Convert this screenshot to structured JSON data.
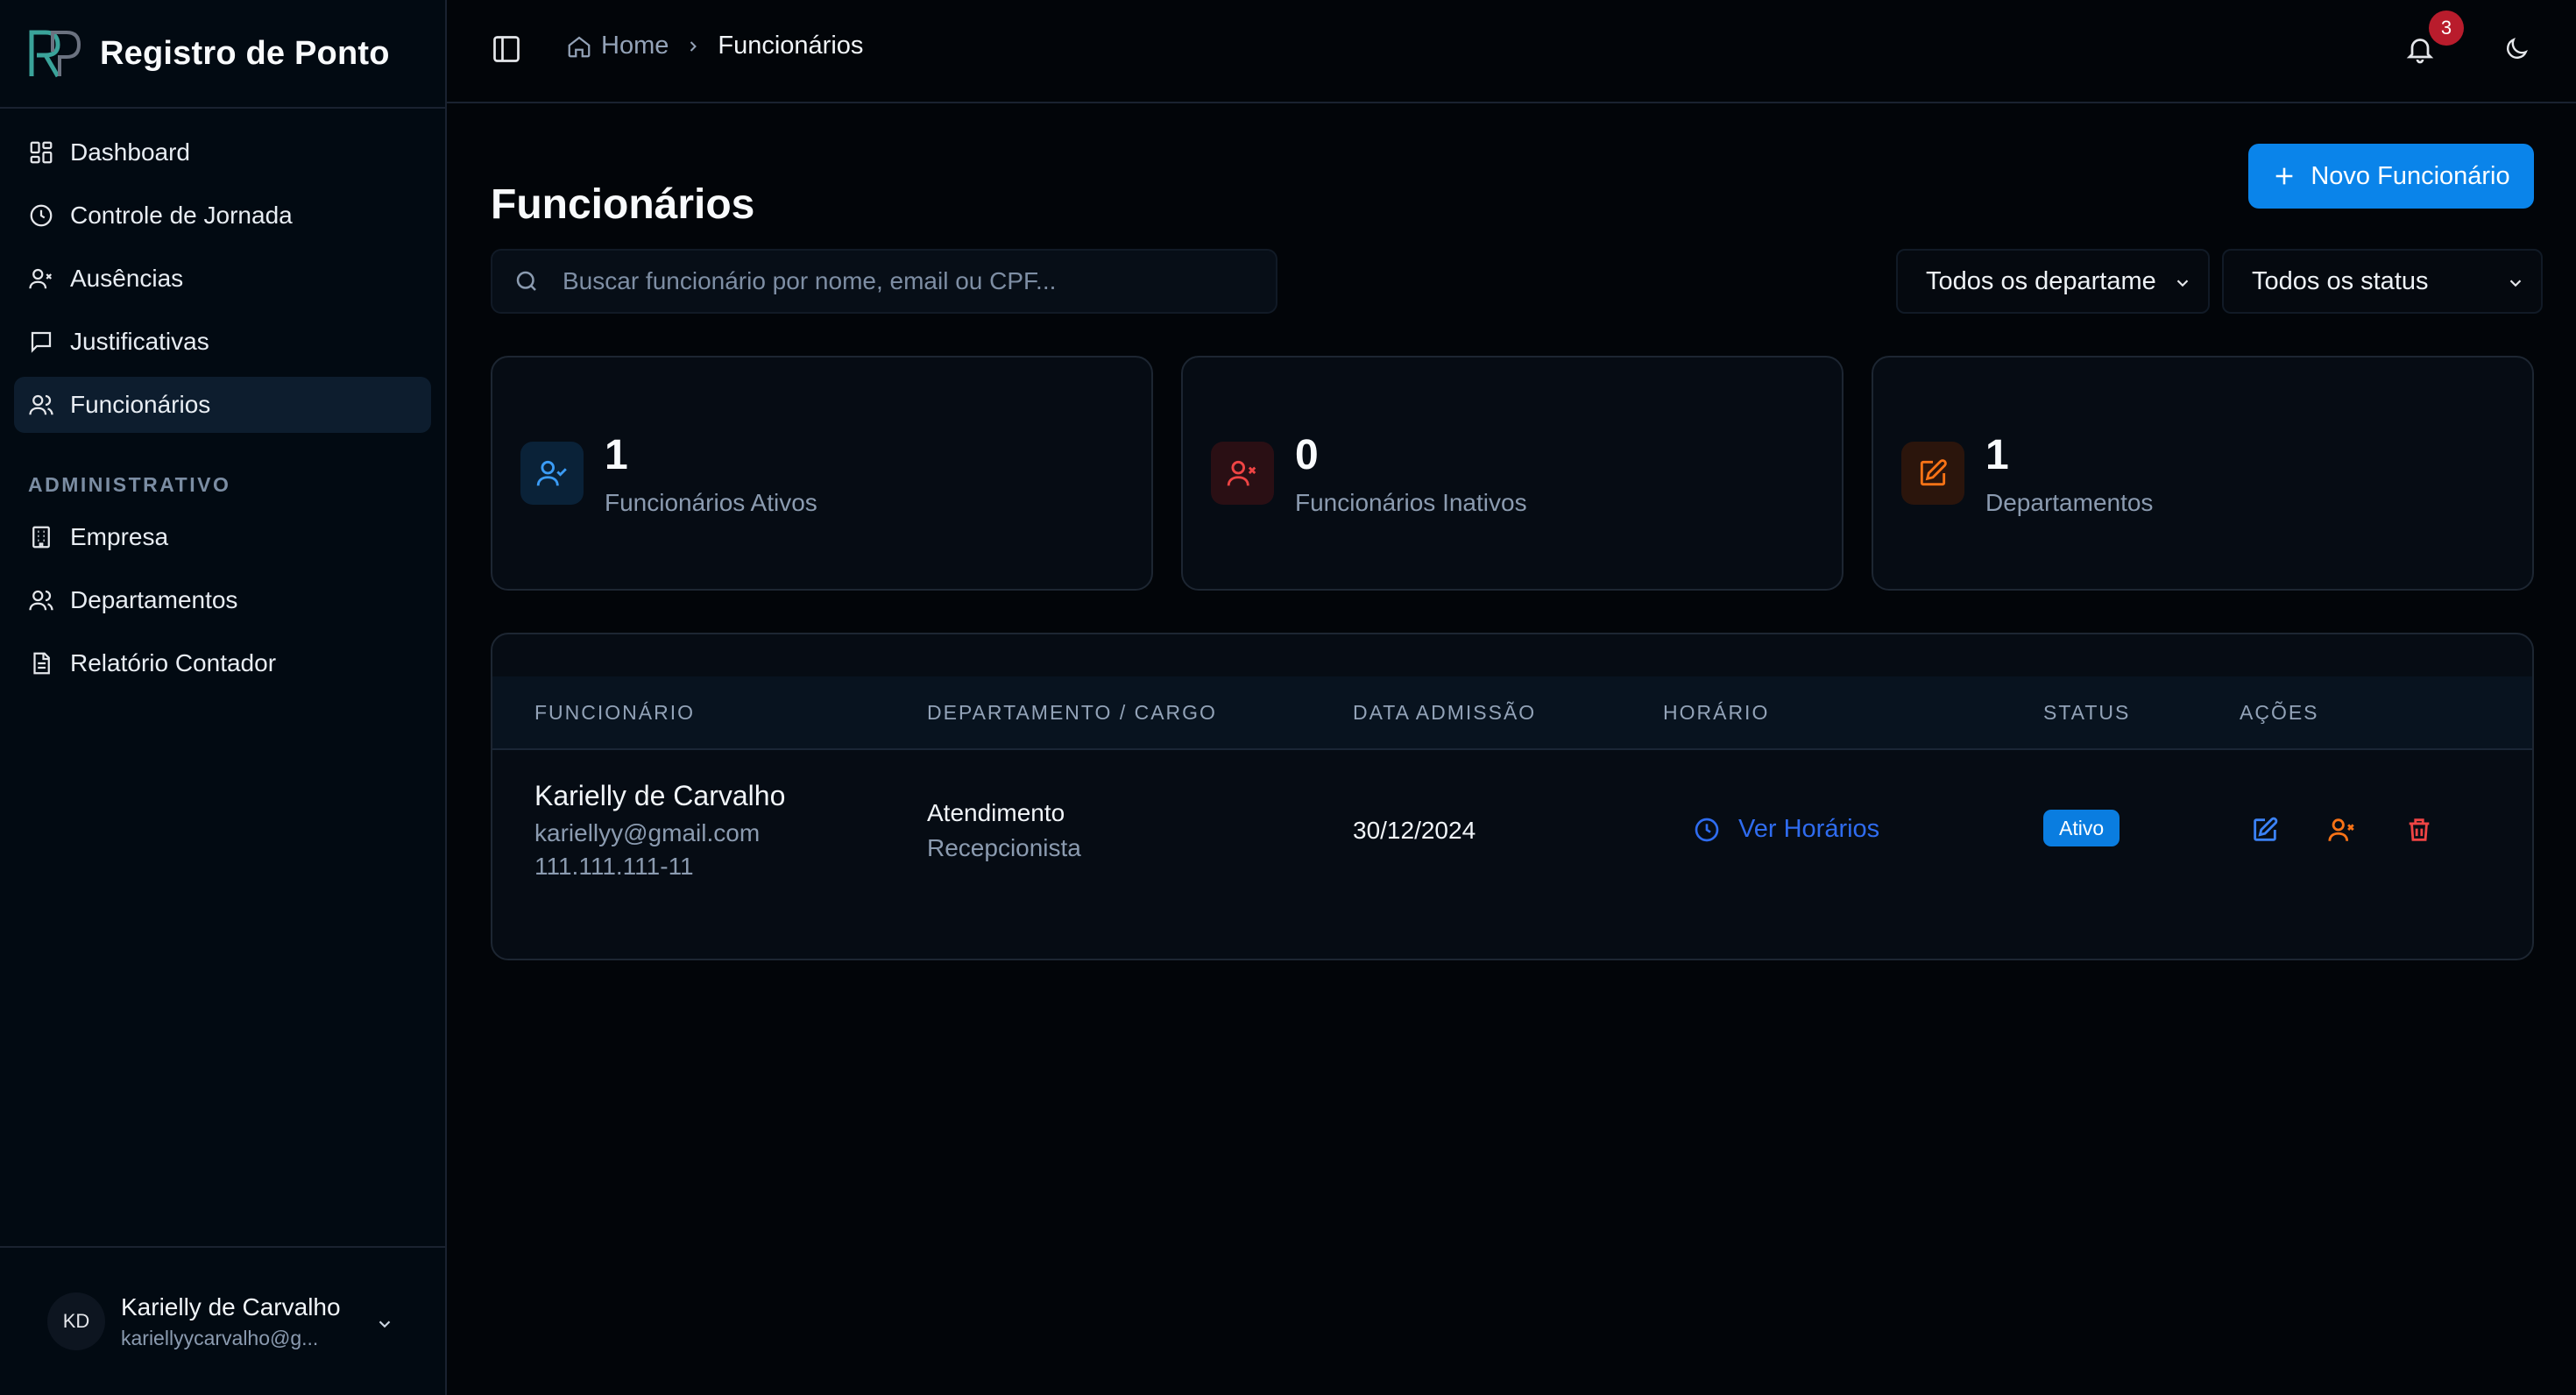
{
  "app": {
    "title": "Registro de Ponto"
  },
  "sidebar": {
    "items": [
      {
        "label": "Dashboard",
        "icon": "dashboard-icon"
      },
      {
        "label": "Controle de Jornada",
        "icon": "clock-icon"
      },
      {
        "label": "Ausências",
        "icon": "user-x-icon"
      },
      {
        "label": "Justificativas",
        "icon": "message-icon"
      },
      {
        "label": "Funcionários",
        "icon": "users-icon",
        "active": true
      }
    ],
    "section_label": "ADMINISTRATIVO",
    "admin_items": [
      {
        "label": "Empresa",
        "icon": "building-icon"
      },
      {
        "label": "Departamentos",
        "icon": "users-icon"
      },
      {
        "label": "Relatório Contador",
        "icon": "file-text-icon"
      }
    ],
    "user": {
      "initials": "KD",
      "name": "Karielly de Carvalho",
      "email": "kariellyycarvalho@g..."
    }
  },
  "topbar": {
    "breadcrumb": {
      "home": "Home",
      "current": "Funcionários"
    },
    "notifications_count": "3"
  },
  "page": {
    "title": "Funcionários",
    "new_button": "Novo Funcionário",
    "search_placeholder": "Buscar funcionário por nome, email ou CPF...",
    "filters": {
      "department": "Todos os departame",
      "status": "Todos os status"
    }
  },
  "stats": [
    {
      "value": "1",
      "label": "Funcionários Ativos"
    },
    {
      "value": "0",
      "label": "Funcionários Inativos"
    },
    {
      "value": "1",
      "label": "Departamentos"
    }
  ],
  "table": {
    "headers": [
      "FUNCIONÁRIO",
      "DEPARTAMENTO / CARGO",
      "DATA ADMISSÃO",
      "HORÁRIO",
      "STATUS",
      "AÇÕES"
    ],
    "rows": [
      {
        "name": "Karielly de Carvalho",
        "email": "kariellyy@gmail.com",
        "cpf": "111.111.111-11",
        "department": "Atendimento",
        "role": "Recepcionista",
        "admission": "30/12/2024",
        "schedule_link": "Ver Horários",
        "status": "Ativo"
      }
    ]
  },
  "colors": {
    "accent": "#0a84ea",
    "danger": "#ef4444",
    "warning": "#f97316",
    "link": "#2f6cf0"
  }
}
